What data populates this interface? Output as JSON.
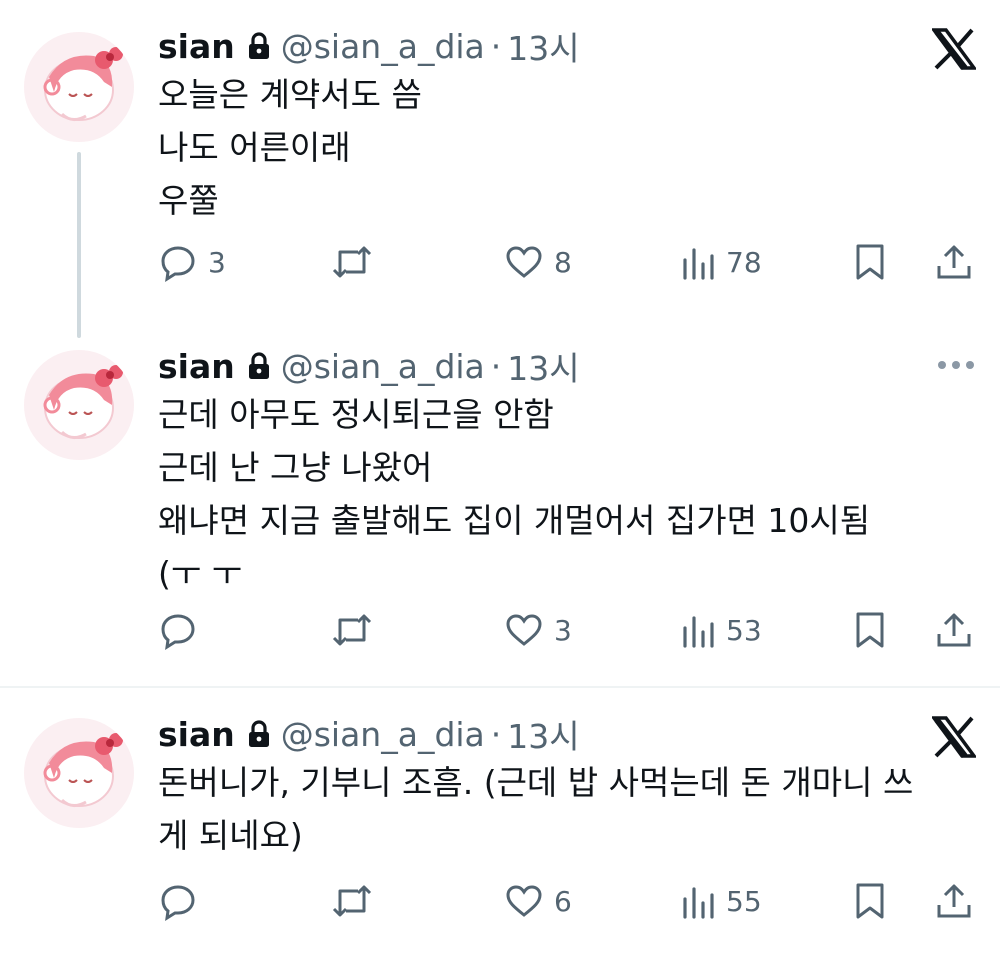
{
  "tweets": [
    {
      "name": "sian",
      "handle": "@sian_a_dia",
      "separator": "·",
      "time": "13시",
      "text": "오늘은 계약서도 씀\n나도 어른이래\n우쭐",
      "corner_icon": "x-logo-icon",
      "replies": "3",
      "likes": "8",
      "views": "78"
    },
    {
      "name": "sian",
      "handle": "@sian_a_dia",
      "separator": "·",
      "time": "13시",
      "text": "근데 아무도 정시퇴근을 안함\n근데 난 그냥 나왔어\n왜냐면 지금 출발해도 집이 개멀어서 집가면 10시됨\n(ㅜ ㅜ",
      "corner_icon": "more-icon",
      "replies": "",
      "likes": "3",
      "views": "53"
    },
    {
      "name": "sian",
      "handle": "@sian_a_dia",
      "separator": "·",
      "time": "13시",
      "text": "돈버니가, 기부니 조흠. (근데 밥 사먹는데 돈 개마니 쓰\n게 되네요)",
      "corner_icon": "x-logo-icon",
      "replies": "",
      "likes": "6",
      "views": "55"
    }
  ],
  "colors": {
    "text": "#0f1419",
    "muted": "#536471",
    "thread_line": "#cfd9de",
    "divider": "#eff3f4",
    "avatar_pink": "#f28b9a"
  }
}
